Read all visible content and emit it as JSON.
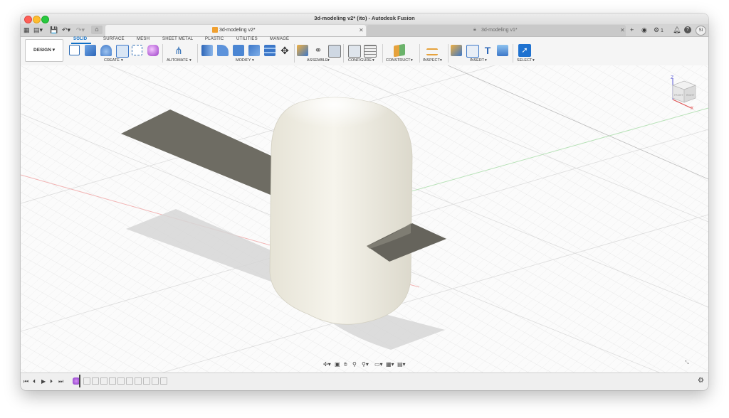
{
  "window": {
    "title": "3d-modeling v2* (ito) - Autodesk Fusion"
  },
  "tabs": [
    {
      "label": "3d-modeling v2*",
      "active": true
    },
    {
      "label": "3d-modeling v1*",
      "active": false
    }
  ],
  "tabbar_right": {
    "jobs_count": "1",
    "user_initials": "SI"
  },
  "workspace": {
    "label": "DESIGN"
  },
  "ribbon_tabs": [
    "SOLID",
    "SURFACE",
    "MESH",
    "SHEET METAL",
    "PLASTIC",
    "UTILITIES",
    "MANAGE"
  ],
  "tool_groups": [
    "CREATE",
    "AUTOMATE",
    "MODIFY",
    "ASSEMBLE",
    "CONFIGURE",
    "CONSTRUCT",
    "INSPECT",
    "INSERT",
    "SELECT"
  ],
  "viewcube": {
    "axis_z": "Z",
    "axis_x": "X",
    "face_front": "FRONT",
    "face_right": "RIGHT"
  },
  "colors": {
    "accent": "#0f6fc6",
    "body": "#efede3",
    "sheet": "#6e6c63",
    "grid": "#e6e6e6"
  }
}
